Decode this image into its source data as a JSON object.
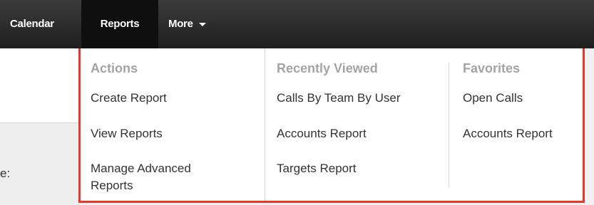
{
  "nav": {
    "items": [
      {
        "label": "Calendar"
      },
      {
        "label": "Reports"
      },
      {
        "label": "More"
      }
    ]
  },
  "page": {
    "partial_label": "e:"
  },
  "dropdown": {
    "columns": [
      {
        "title": "Actions",
        "items": [
          "Create Report",
          "View Reports",
          "Manage Advanced Reports"
        ]
      },
      {
        "title": "Recently Viewed",
        "items": [
          "Calls By Team By User",
          "Accounts Report",
          "Targets Report"
        ]
      },
      {
        "title": "Favorites",
        "items": [
          "Open Calls",
          "Accounts Report"
        ]
      }
    ]
  },
  "colors": {
    "highlight_border": "#e8382a",
    "nav_bg": "#2a2a2a",
    "active_tab_bg": "#0f0f0f",
    "section_title": "#a4a4a4"
  }
}
